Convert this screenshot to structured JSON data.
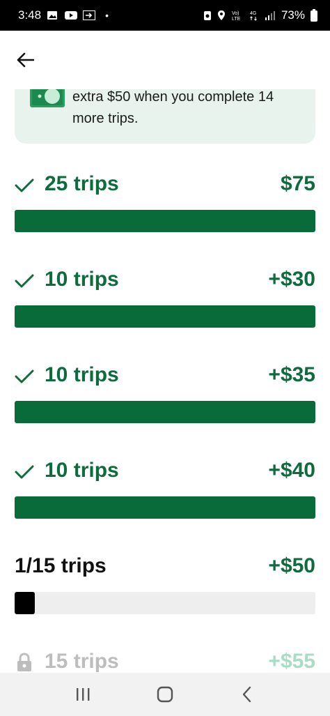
{
  "status_bar": {
    "time": "3:48",
    "dot": "•",
    "battery": "73%",
    "icons": [
      "gallery-icon",
      "youtube-icon",
      "cast-icon",
      "nfc-icon",
      "location-icon",
      "volte-icon",
      "4g-icon",
      "signal-icon",
      "battery-icon"
    ]
  },
  "banner": {
    "text": "extra $50 when you complete 14 more trips."
  },
  "tiers": [
    {
      "label": "25 trips",
      "amount": "$75",
      "state": "completed",
      "progress": 1.0
    },
    {
      "label": "10 trips",
      "amount": "+$30",
      "state": "completed",
      "progress": 1.0
    },
    {
      "label": "10 trips",
      "amount": "+$35",
      "state": "completed",
      "progress": 1.0
    },
    {
      "label": "10 trips",
      "amount": "+$40",
      "state": "completed",
      "progress": 1.0
    },
    {
      "label": "1/15 trips",
      "amount": "+$50",
      "state": "in-progress",
      "progress": 0.0667
    },
    {
      "label": "15 trips",
      "amount": "+$55",
      "state": "locked",
      "progress": 0
    }
  ],
  "colors": {
    "accent_green": "#0a6b3a",
    "banner_bg": "#e8f3ee",
    "locked_amount": "#a9dcc4"
  }
}
